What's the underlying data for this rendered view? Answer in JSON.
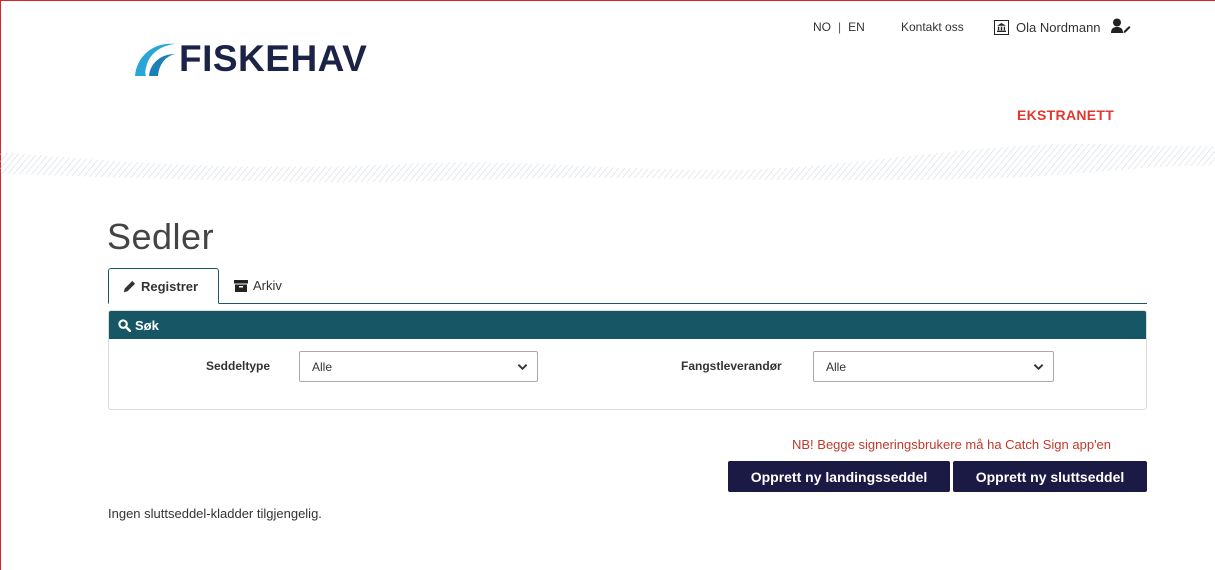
{
  "header": {
    "logo_text": "FISKEHAV",
    "lang": [
      "NO",
      "EN"
    ],
    "lang_separator": "|",
    "contact_label": "Kontakt oss",
    "user_name": "Ola Nordmann",
    "section_label": "EKSTRANETT"
  },
  "page": {
    "title": "Sedler",
    "tabs": [
      {
        "label": "Registrer",
        "icon": "pencil-icon",
        "active": true
      },
      {
        "label": "Arkiv",
        "icon": "archive-icon",
        "active": false
      }
    ]
  },
  "search": {
    "title": "Søk",
    "fields": [
      {
        "label": "Seddeltype",
        "value": "Alle"
      },
      {
        "label": "Fangstleverandør",
        "value": "Alle"
      }
    ]
  },
  "actions": {
    "notice": "NB! Begge signeringsbrukere må ha Catch Sign app'en",
    "new_landing_label": "Opprett ny landingsseddel",
    "new_final_label": "Opprett ny sluttseddel"
  },
  "empty_message": "Ingen sluttseddel-kladder tilgjengelig.",
  "colors": {
    "brand_navy": "#1b2346",
    "accent_red": "#e0382f",
    "panel_teal": "#165665",
    "button_navy": "#1a1a44",
    "logo_wave": "#2aa5d8"
  }
}
